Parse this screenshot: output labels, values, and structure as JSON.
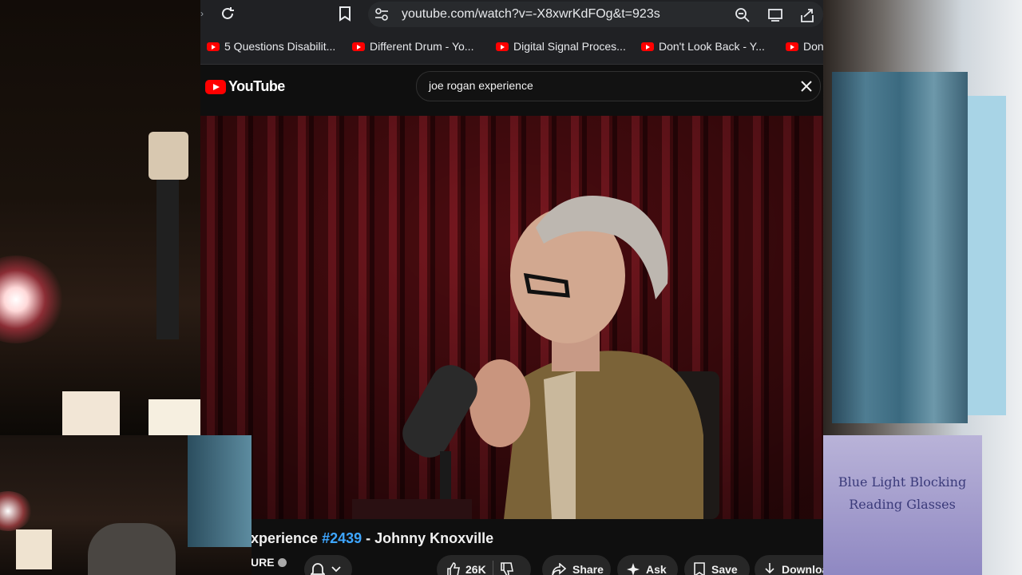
{
  "browser": {
    "url": "youtube.com/watch?v=-X8xwrKdFOg&t=923s",
    "bookmarks": [
      {
        "label": "5 Questions Disabilit..."
      },
      {
        "label": "Different Drum - Yo..."
      },
      {
        "label": "Digital Signal Proces..."
      },
      {
        "label": "Don't Look Back - Y..."
      },
      {
        "label": "Don"
      }
    ]
  },
  "youtube": {
    "logo_text": "YouTube",
    "search_value": "joe rogan experience",
    "video_title_prefix": "xperience",
    "video_title_hashtag": "#2439",
    "video_title_suffix": "- Johnny Knoxville",
    "channel_name_partial": "URE",
    "actions": {
      "likes": "26K",
      "share": "Share",
      "ask": "Ask",
      "save": "Save",
      "download": "Download"
    }
  },
  "webcam_overlay": {
    "box_text_line1": "Blue Light Blocking",
    "box_text_line2": "Reading Glasses"
  },
  "colors": {
    "youtube_red": "#ff0000",
    "hashtag_blue": "#3ea6ff",
    "chrome_bg": "#202124"
  }
}
